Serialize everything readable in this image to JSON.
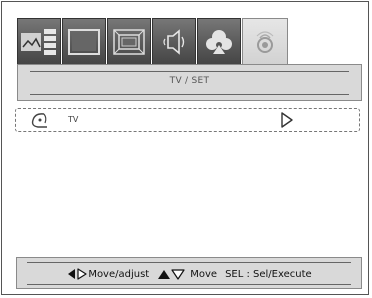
{
  "tabs": [
    {
      "icon": "picture-icon",
      "active": false
    },
    {
      "icon": "screen-icon",
      "active": false
    },
    {
      "icon": "display-adjust-icon",
      "active": false
    },
    {
      "icon": "audio-speaker-icon",
      "active": false
    },
    {
      "icon": "setup-icon",
      "active": false
    },
    {
      "icon": "tv-setup-icon",
      "active": true
    }
  ],
  "panel": {
    "title": "TV / SET"
  },
  "list": [
    {
      "label": "TV",
      "icon": "tv-item-icon",
      "arrow": "right-arrow-icon"
    }
  ],
  "footer": {
    "move_adjust": "Move/adjust",
    "move": "Move",
    "select": "SEL : Sel/Execute"
  }
}
